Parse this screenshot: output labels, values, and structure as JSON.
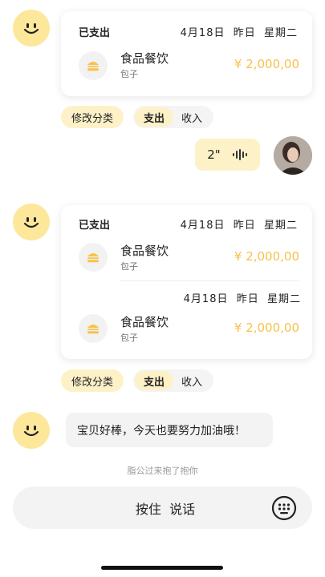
{
  "messages": {
    "bill1": {
      "status": "已支出",
      "date": "4月18日  昨日  星期二",
      "entries": [
        {
          "category": "食品餐饮",
          "subtitle": "包子",
          "amount": "¥ 2,000,00",
          "icon": "burger-icon"
        }
      ]
    },
    "chips1": {
      "modify": "修改分类",
      "expense": "支出",
      "income": "收入"
    },
    "voice": {
      "duration": "2\"",
      "icon": "voice-wave-icon"
    },
    "bill2": {
      "status": "已支出",
      "date1": "4月18日  昨日  星期二",
      "date2": "4月18日  昨日  星期二",
      "entries": [
        {
          "category": "食品餐饮",
          "subtitle": "包子",
          "amount": "¥ 2,000,00",
          "icon": "burger-icon"
        },
        {
          "category": "食品餐饮",
          "subtitle": "包子",
          "amount": "¥ 2,000,00",
          "icon": "burger-icon"
        }
      ]
    },
    "chips2": {
      "modify": "修改分类",
      "expense": "支出",
      "income": "收入"
    },
    "encourage": "宝贝好棒，今天也要努力加油哦！",
    "system_hint": "脂公过来抱了抱你"
  },
  "input_bar": {
    "hold_to_talk": "按住  说话",
    "keyboard_icon": "keyboard-icon"
  },
  "colors": {
    "accent_yellow": "#f7c24a",
    "chip_yellow": "#fdf1c8",
    "avatar_yellow": "#fde79a"
  }
}
